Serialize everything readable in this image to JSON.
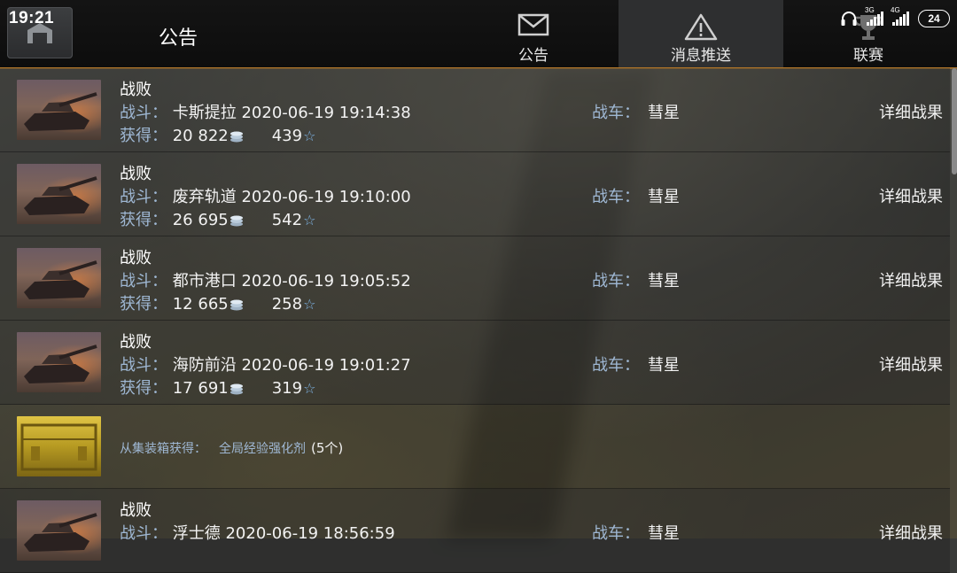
{
  "status_bar": {
    "time": "19:21",
    "battery": "24",
    "signal_tags": [
      "3G",
      "4G"
    ]
  },
  "header": {
    "title": "公告"
  },
  "tabs": [
    {
      "label": "公告",
      "icon": "envelope-icon",
      "selected": false
    },
    {
      "label": "消息推送",
      "icon": "warning-triangle-icon",
      "selected": true
    },
    {
      "label": "联赛",
      "icon": "trophy-icon",
      "selected": false
    }
  ],
  "labels": {
    "battle": "战斗：",
    "earned": "获得：",
    "tank": "战车：",
    "detail": "详细战果"
  },
  "battles": [
    {
      "result": "战败",
      "map": "卡斯提拉",
      "datetime": "2020-06-19 19:14:38",
      "tank": "彗星",
      "credits": "20 822",
      "exp": "439"
    },
    {
      "result": "战败",
      "map": "废弃轨道",
      "datetime": "2020-06-19 19:10:00",
      "tank": "彗星",
      "credits": "26 695",
      "exp": "542"
    },
    {
      "result": "战败",
      "map": "都市港口",
      "datetime": "2020-06-19 19:05:52",
      "tank": "彗星",
      "credits": "12 665",
      "exp": "258"
    },
    {
      "result": "战败",
      "map": "海防前沿",
      "datetime": "2020-06-19 19:01:27",
      "tank": "彗星",
      "credits": "17 691",
      "exp": "319"
    }
  ],
  "crate": {
    "source": "从集装箱获得：",
    "item": "全局经验强化剂",
    "qty": "(5个)"
  },
  "last_battle": {
    "result": "战败",
    "map": "浮士德",
    "datetime": "2020-06-19 18:56:59",
    "tank": "彗星"
  }
}
